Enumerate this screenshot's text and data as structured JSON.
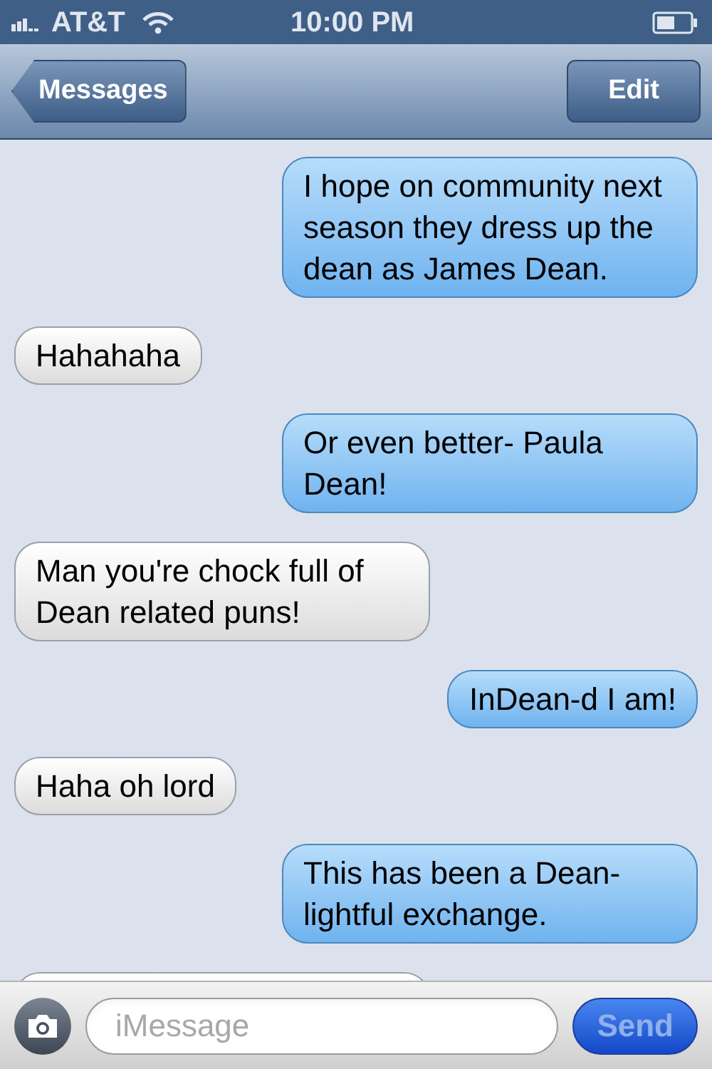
{
  "status_bar": {
    "carrier": "AT&T",
    "time": "10:00 PM"
  },
  "nav_bar": {
    "back_button": "Messages",
    "edit_button": "Edit"
  },
  "messages": [
    {
      "kind": "sent",
      "text": "I hope on community next season they dress up the dean as James Dean."
    },
    {
      "kind": "received",
      "text": "Hahahaha"
    },
    {
      "kind": "sent",
      "text": "Or even better- Paula Dean!"
    },
    {
      "kind": "received",
      "text": "Man you're chock full of Dean related puns!"
    },
    {
      "kind": "sent",
      "text": "InDean-d I am!"
    },
    {
      "kind": "received",
      "text": "Haha oh lord"
    },
    {
      "kind": "sent",
      "text": "This has been a Dean-lightful exchange."
    },
    {
      "kind": "received"
    }
  ],
  "input_bar": {
    "placeholder": "iMessage",
    "send_button": {
      "label": "Send",
      "disabled": true
    }
  }
}
